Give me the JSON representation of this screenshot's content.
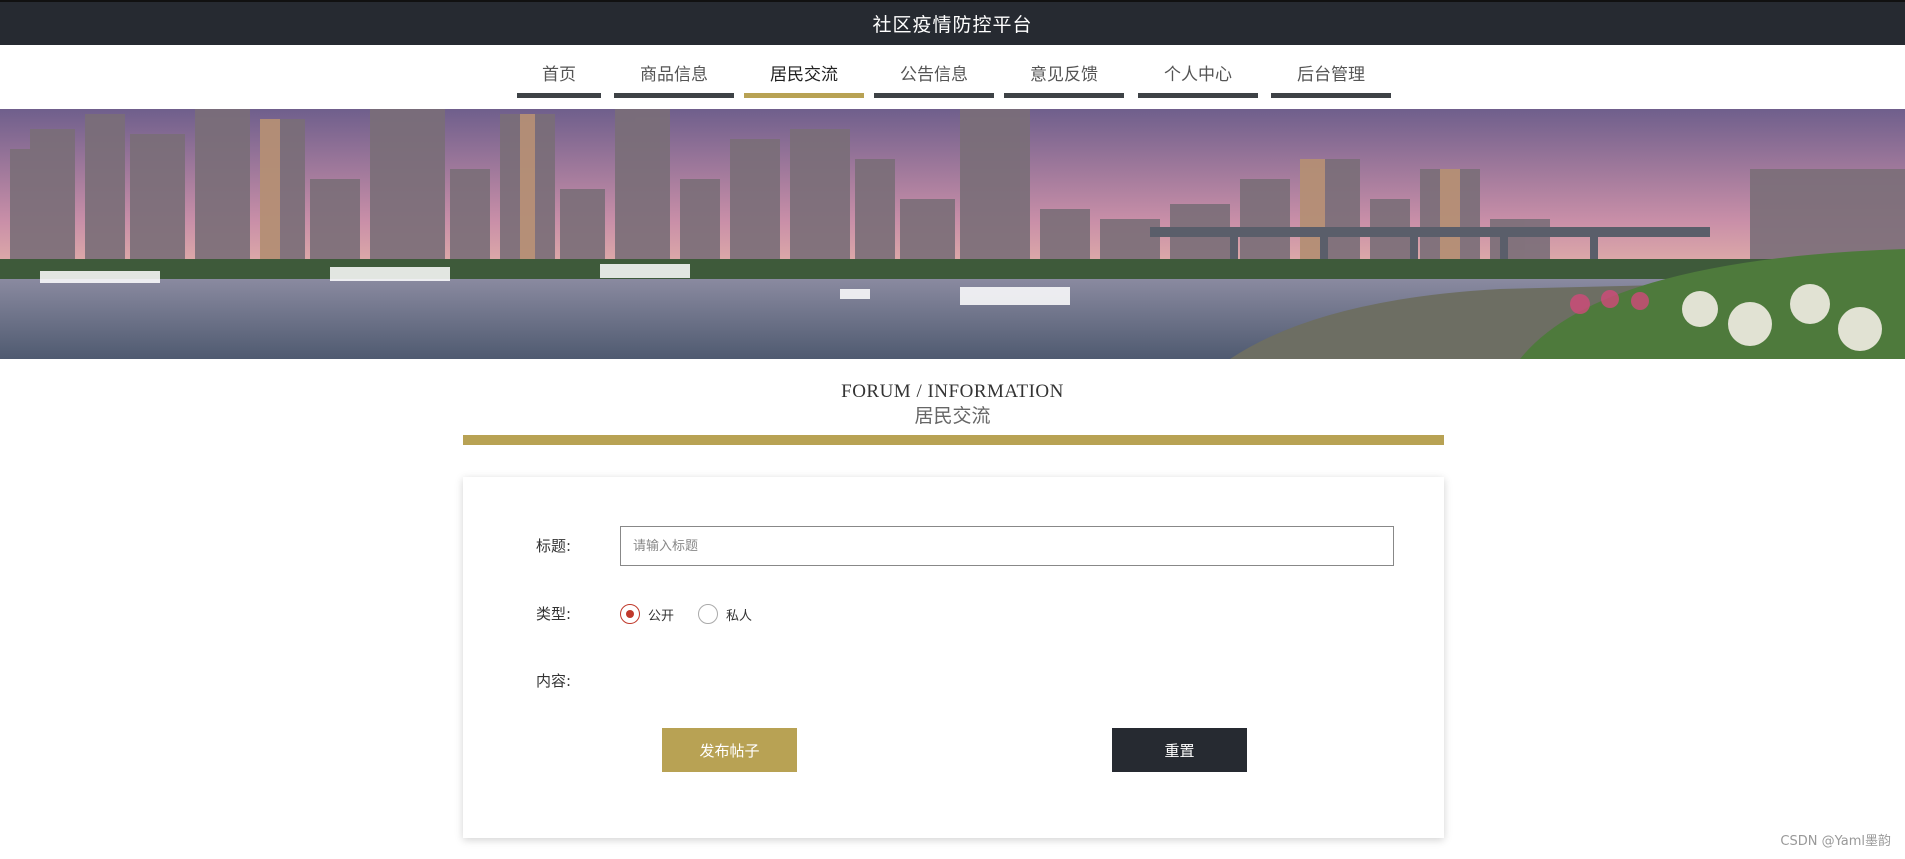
{
  "site": {
    "title": "社区疫情防控平台"
  },
  "nav": {
    "items": [
      {
        "label": "首页"
      },
      {
        "label": "商品信息"
      },
      {
        "label": "居民交流"
      },
      {
        "label": "公告信息"
      },
      {
        "label": "意见反馈"
      },
      {
        "label": "个人中心"
      },
      {
        "label": "后台管理"
      }
    ],
    "active": "居民交流"
  },
  "section": {
    "heading_en": "FORUM / INFORMATION",
    "heading_cn": "居民交流"
  },
  "form": {
    "title_label": "标题:",
    "title_placeholder": "请输入标题",
    "type_label": "类型:",
    "type_options": [
      {
        "label": "公开",
        "checked": true
      },
      {
        "label": "私人",
        "checked": false
      }
    ],
    "content_label": "内容:",
    "submit_label": "发布帖子",
    "reset_label": "重置"
  },
  "watermark": "CSDN @Yaml墨韵",
  "colors": {
    "accent": "#b8a254",
    "dark": "#262a31",
    "radio_checked": "#c0392b"
  }
}
